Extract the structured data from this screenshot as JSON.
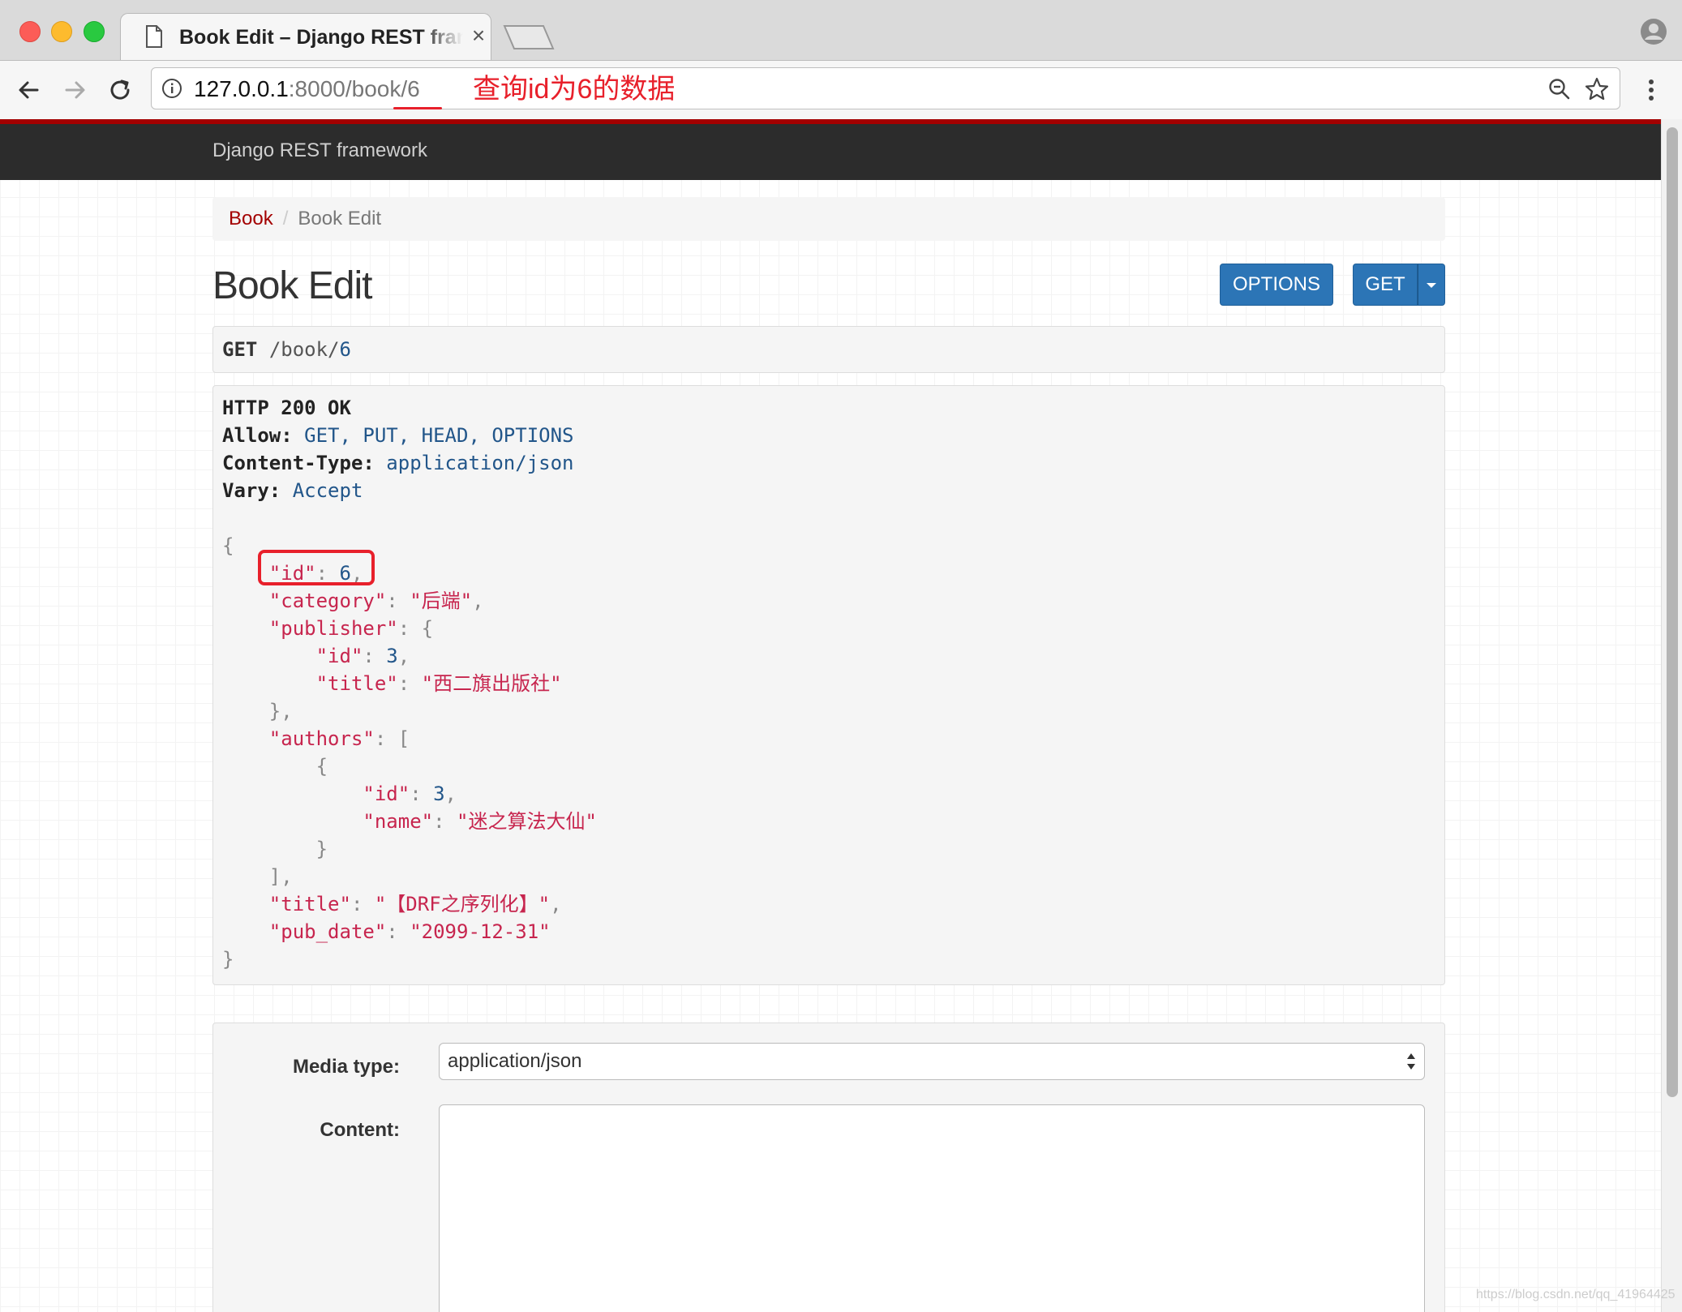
{
  "browser": {
    "tab_title": "Book Edit – Django REST framework",
    "tab_close": "×",
    "url_host": "127.0.0.1",
    "url_port": ":8000",
    "url_path": "/book/6",
    "annotation": "查询id为6的数据",
    "annotation_color": "#e8202b"
  },
  "navbar": {
    "brand": "Django REST framework"
  },
  "breadcrumb": {
    "parent": "Book",
    "separator": "/",
    "current": "Book Edit"
  },
  "page": {
    "title": "Book Edit",
    "options_button": "OPTIONS",
    "get_button": "GET"
  },
  "request": {
    "method": "GET",
    "path": "/book/",
    "id": "6"
  },
  "response": {
    "status": "HTTP 200 OK",
    "headers": [
      {
        "key": "Allow:",
        "value": "GET, PUT, HEAD, OPTIONS"
      },
      {
        "key": "Content-Type:",
        "value": "application/json"
      },
      {
        "key": "Vary:",
        "value": "Accept"
      }
    ],
    "body": {
      "id": "6",
      "category": "后端",
      "publisher_id": "3",
      "publisher_title": "西二旗出版社",
      "author_id": "3",
      "author_name": "迷之算法大仙",
      "title": "【DRF之序列化】",
      "pub_date": "2099-12-31"
    }
  },
  "form": {
    "media_type_label": "Media type:",
    "media_type_value": "application/json",
    "content_label": "Content:"
  },
  "watermark": "https://blog.csdn.net/qq_41964425",
  "colors": {
    "accent": "#a30000",
    "button": "#2c75b6",
    "json_key": "#c7254e",
    "json_value": "#22568a"
  }
}
